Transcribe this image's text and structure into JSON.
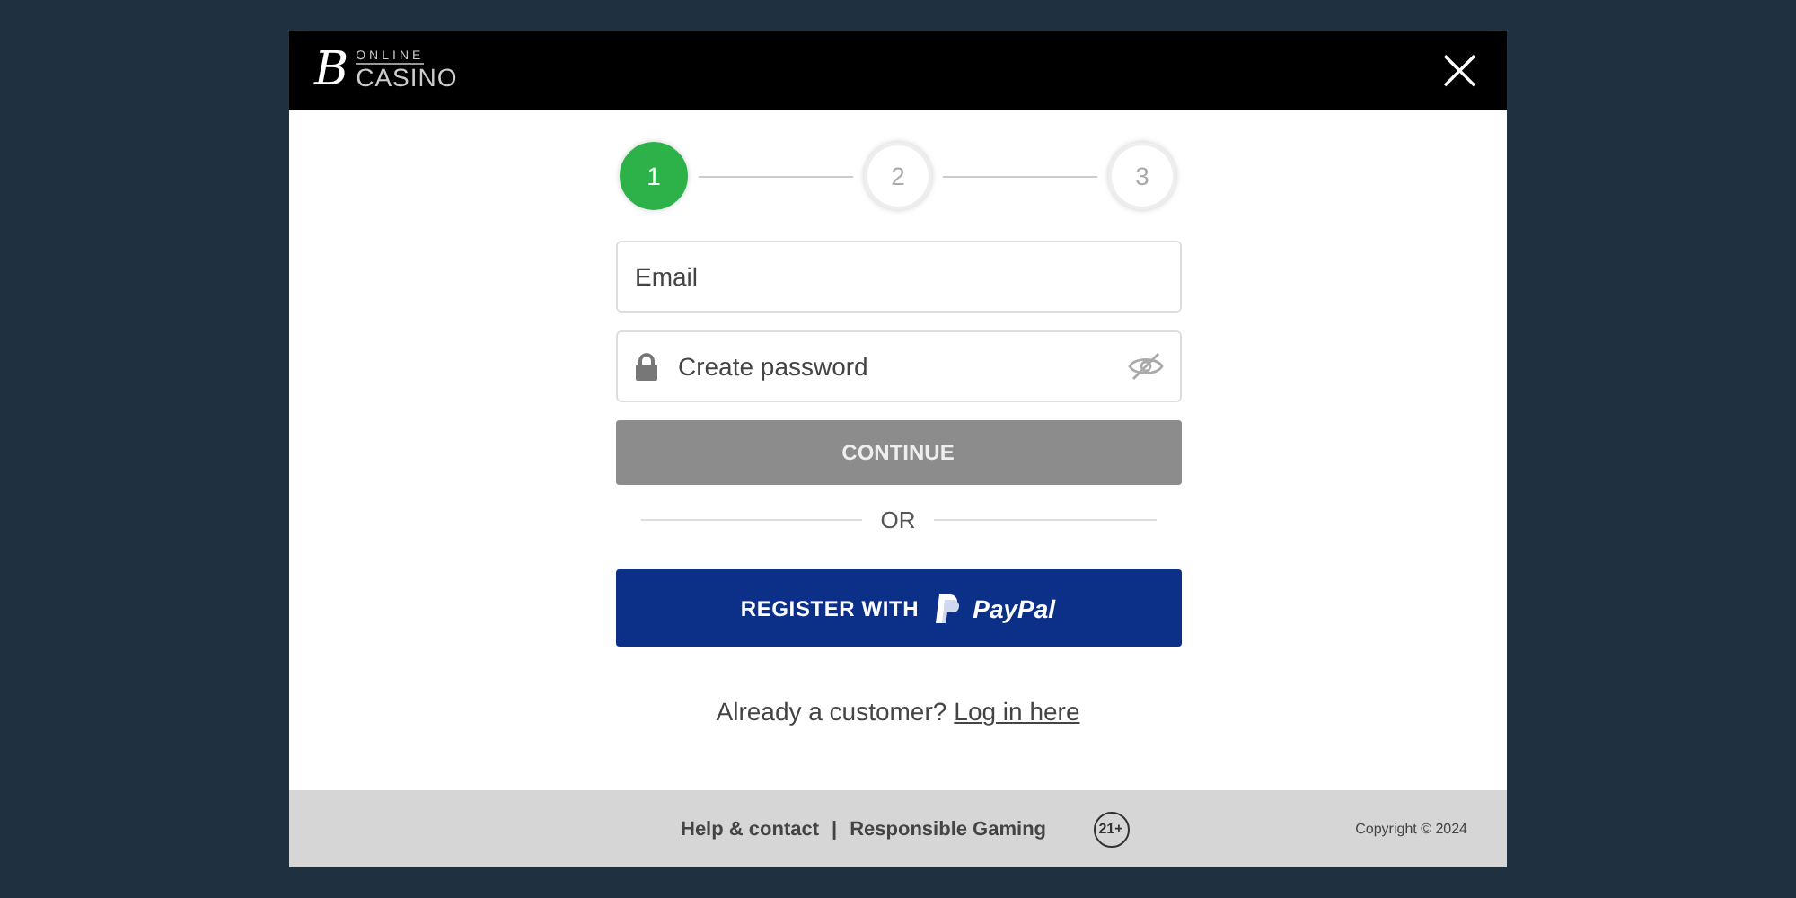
{
  "header": {
    "logo_mark": "B",
    "logo_small": "ONLINE",
    "logo_big": "CASINO",
    "close": "×"
  },
  "steps": [
    {
      "label": "1",
      "selected": true
    },
    {
      "label": "2",
      "selected": false
    },
    {
      "label": "3",
      "selected": false
    }
  ],
  "email": {
    "placeholder": "Email"
  },
  "password": {
    "placeholder": "Create password"
  },
  "continue_button": {
    "label": "CONTINUE",
    "disabled": true
  },
  "divider": "OR",
  "paypal_button": {
    "label": "REGISTER WITH",
    "brand": "PayPal"
  },
  "login_prompt": {
    "text": "Already a customer?",
    "link": "Log in here"
  },
  "footer": {
    "links": [
      "Help & contact",
      "Responsible Gaming"
    ],
    "separator": "|",
    "age_badge": "21+",
    "copyright": "Copyright © 2024"
  }
}
